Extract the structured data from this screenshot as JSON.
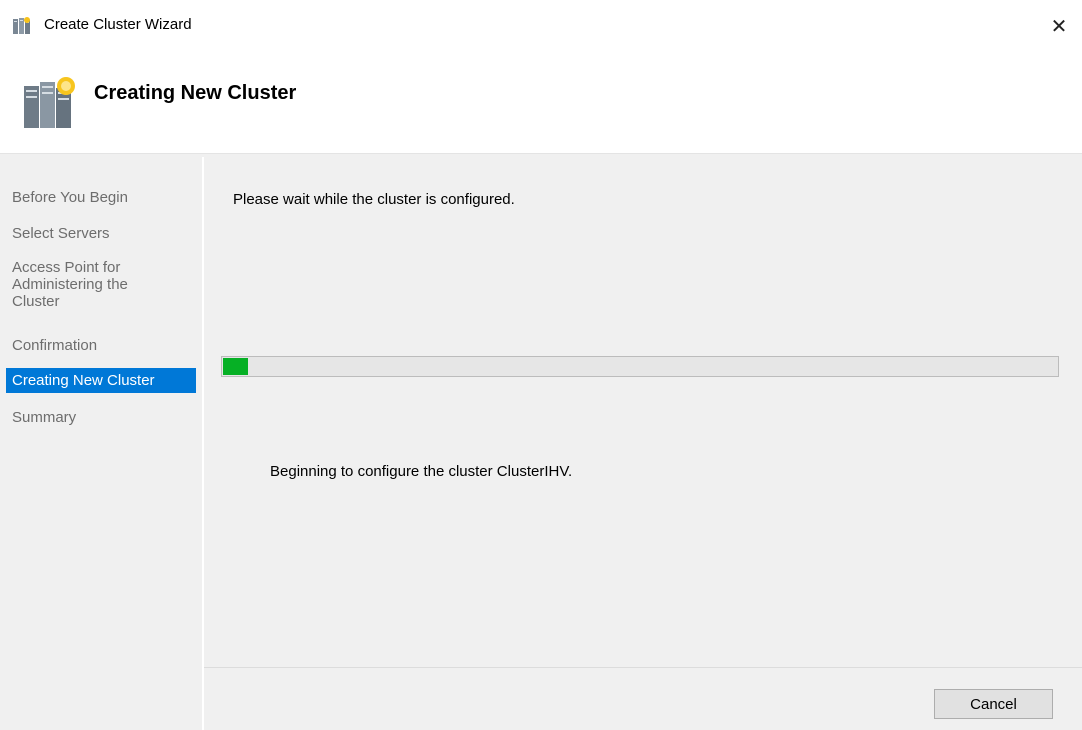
{
  "window": {
    "title": "Create Cluster Wizard",
    "close_glyph": "✕",
    "app_icon": "cluster-servers-icon"
  },
  "header": {
    "title": "Creating New Cluster",
    "icon": "cluster-servers-icon"
  },
  "nav": {
    "items": [
      {
        "label": "Before You Begin",
        "active": false
      },
      {
        "label": "Select Servers",
        "active": false
      },
      {
        "label": "Access Point for Administering the Cluster",
        "active": false
      },
      {
        "label": "Confirmation",
        "active": false
      },
      {
        "label": "Creating New Cluster",
        "active": true
      },
      {
        "label": "Summary",
        "active": false
      }
    ]
  },
  "main": {
    "wait_message": "Please wait while the cluster is configured.",
    "progress_fraction": 0.03,
    "status_message": "Beginning to configure the cluster ClusterIHV."
  },
  "footer": {
    "cancel_label": "Cancel"
  },
  "colors": {
    "accent": "#0078d7",
    "progress": "#06b025"
  }
}
